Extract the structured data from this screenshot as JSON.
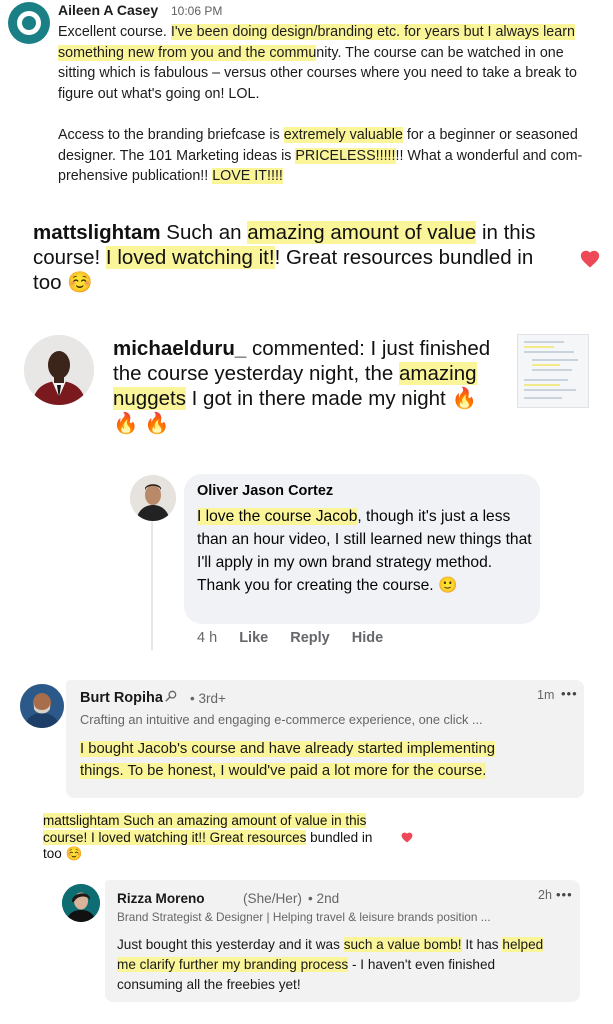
{
  "slack_comment": {
    "author": "Aileen A Casey",
    "time": "10:06 PM",
    "p1_a": "Excellent course. ",
    "p1_hl1": "I've been doing design/branding etc. for years but I always learn something new from you and the commu",
    "p1_b": "nity. The course can be watched in one sitting which is fabulous – versus other courses where you need to take a break to figure out what's going on! LOL.",
    "p2_a": "Access to the branding briefcase is ",
    "p2_hl1": "extremely valuable",
    "p2_b": " for a beginner or seasoned designer. The 101 Marketing ideas is ",
    "p2_hl2": "PRICELESS!!!!!",
    "p2_c": "!! What a wonderful and com-prehensive publication!! ",
    "p2_hl3": "LOVE IT!!!! "
  },
  "ig_comment_1": {
    "username": "mattslightam",
    "t1": " Such an ",
    "hl1": "amazing amount of value",
    "t2": " in this course! ",
    "hl2": "I loved watching it!",
    "t3": "! Great resources bundled in too ☺️",
    "like_icon": "heart-icon",
    "accent": "#ed4956"
  },
  "ig_comment_2": {
    "username": "michaelduru_",
    "t1": " commented: I just finished the course yesterday night, the ",
    "hl1": "amazing nuggets",
    "t2": " I got in there made my night 🔥 🔥 🔥"
  },
  "fb_reply": {
    "author": "Oliver Jason Cortez",
    "hl1": "I love the course Jacob",
    "t1": ", though it's just a less than an hour video, I still learned new things that I'll apply in my own brand strategy method. Thank you for creating the course. 🙂",
    "time": "4 h",
    "like": "Like",
    "reply": "Reply",
    "hide": "Hide"
  },
  "li_comment_1": {
    "author": "Burt Ropiha",
    "degree": "• 3rd+",
    "time": "1m",
    "more": "•••",
    "headline": "Crafting an intuitive and engaging e-commerce experience, one click ...",
    "hl1": "I bought Jacob's course and have already started implementing things. To be honest, I would've paid a lot more for the course."
  },
  "ig_comment_3": {
    "hl1": "mattslightam Such an amazing amount of value in this course! I loved watching it!! Great resources",
    "t1": " bundled in too ☺️"
  },
  "li_comment_2": {
    "author": "Rizza Moreno",
    "pronouns": "(She/Her)",
    "degree": "• 2nd",
    "time": "2h",
    "more": "•••",
    "headline": "Brand Strategist & Designer | Helping travel & leisure brands position ...",
    "t1": "Just bought this yesterday and it was ",
    "hl1": "such a value bomb!",
    "t2": " It has ",
    "hl2": "helped me clarify further my branding process",
    "t3": " - I haven't even finished consuming all the freebies yet!"
  }
}
